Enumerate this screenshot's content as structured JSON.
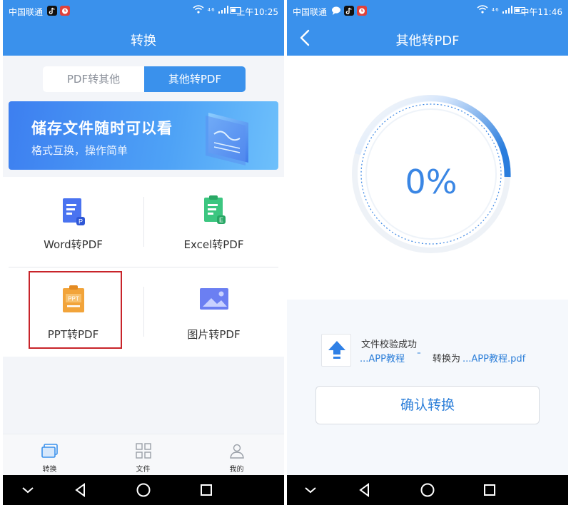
{
  "left_screen": {
    "status_bar": {
      "carrier": "中国联通",
      "time": "上午10:25",
      "signal_label": "⁴⁶",
      "app_icons": [
        "tiktok-icon",
        "clock-app-icon"
      ]
    },
    "title": "转换",
    "segment": {
      "left_label": "PDF转其他",
      "right_label": "其他转PDF",
      "selected": "其他转PDF"
    },
    "banner": {
      "title": "储存文件随时可以看",
      "subtitle": "格式互换，操作简单"
    },
    "converters": [
      {
        "label": "Word转PDF",
        "icon": "word-doc-icon"
      },
      {
        "label": "Excel转PDF",
        "icon": "excel-doc-icon"
      },
      {
        "label": "PPT转PDF",
        "icon": "ppt-doc-icon",
        "icon_text": "PPT",
        "highlighted": true
      },
      {
        "label": "图片转PDF",
        "icon": "image-icon"
      }
    ],
    "tabs": [
      {
        "label": "转换",
        "icon": "convert-tab-icon",
        "active": true
      },
      {
        "label": "文件",
        "icon": "files-tab-icon",
        "active": false
      },
      {
        "label": "我的",
        "icon": "profile-tab-icon",
        "active": false
      }
    ]
  },
  "right_screen": {
    "status_bar": {
      "carrier": "中国联通",
      "time": "中午11:46",
      "signal_label": "⁴⁶",
      "app_icons": [
        "chat-icon",
        "tiktok-icon",
        "clock-app-icon"
      ]
    },
    "title": "其他转PDF",
    "progress": {
      "percent_text": "0%",
      "value": 0
    },
    "file": {
      "status": "文件校验成功",
      "source_name": "...APP教程",
      "arrow": "⁼",
      "convert_prefix": "转换为",
      "target_name": "...APP教程.pdf"
    },
    "confirm_label": "确认转换"
  },
  "colors": {
    "primary": "#3a91ec",
    "accent_text": "#2d7fd9",
    "highlight_border": "#c8242a",
    "ppt_orange": "#f2a43a",
    "excel_green": "#3cc680",
    "word_blue": "#4a73f0"
  }
}
